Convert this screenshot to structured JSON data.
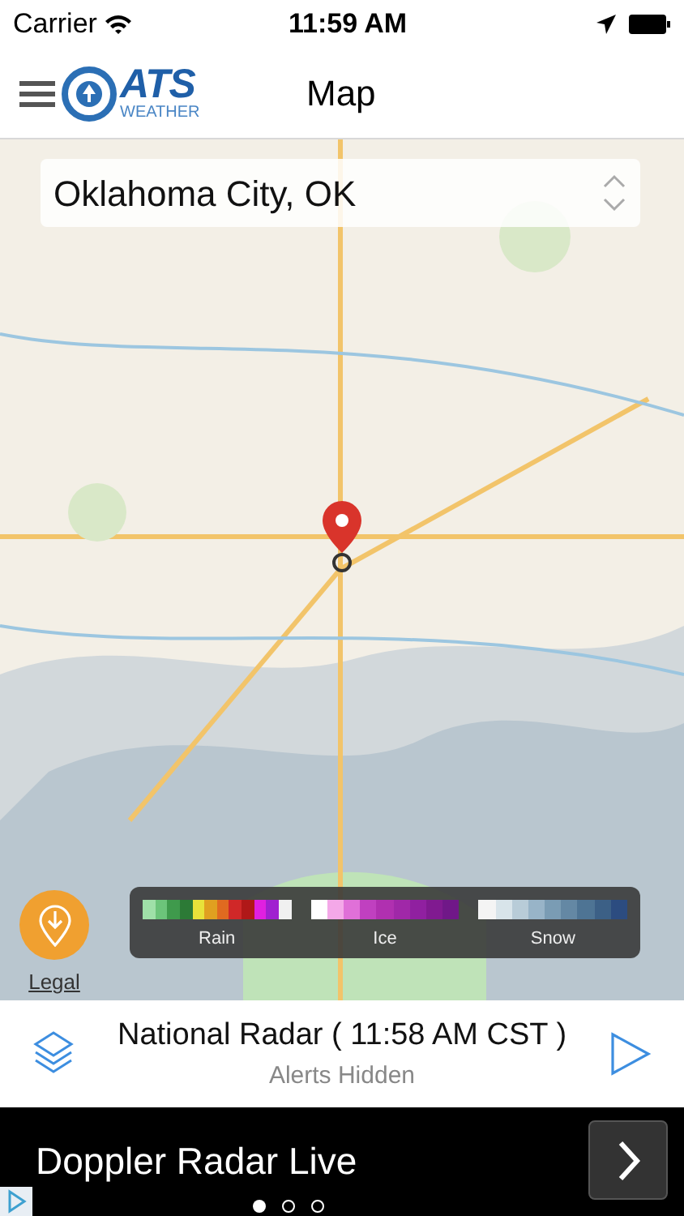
{
  "status_bar": {
    "carrier": "Carrier",
    "time": "11:59 AM"
  },
  "nav": {
    "logo_main": "ATS",
    "logo_sub": "WEATHER",
    "title": "Map"
  },
  "map": {
    "search": {
      "value": "Oklahoma City, OK"
    },
    "legend": [
      {
        "label": "Rain",
        "swatches": [
          {
            "color": "#9fe0a8"
          },
          {
            "color": "#6cc47a"
          },
          {
            "color": "#3f9a4c"
          },
          {
            "color": "#2c7a36"
          },
          {
            "color": "#e8e23a"
          },
          {
            "color": "#e0a020"
          },
          {
            "color": "#e06a20"
          },
          {
            "color": "#d02828"
          },
          {
            "color": "#b01818"
          },
          {
            "color": "#e020e0"
          },
          {
            "color": "#a020d0"
          },
          {
            "color": "#f0f0f0"
          }
        ]
      },
      {
        "label": "Ice",
        "swatches": [
          {
            "color": "#ffffff"
          },
          {
            "color": "#f4a8e8"
          },
          {
            "color": "#e070d8"
          },
          {
            "color": "#c040c0"
          },
          {
            "color": "#b030b0"
          },
          {
            "color": "#a028a8"
          },
          {
            "color": "#9020a0"
          },
          {
            "color": "#801a90"
          },
          {
            "color": "#701888"
          }
        ]
      },
      {
        "label": "Snow",
        "swatches": [
          {
            "color": "#f4f4f4"
          },
          {
            "color": "#d8e4ea"
          },
          {
            "color": "#b8ccd8"
          },
          {
            "color": "#98b4c8"
          },
          {
            "color": "#7a9cb4"
          },
          {
            "color": "#6488a4"
          },
          {
            "color": "#4e7494"
          },
          {
            "color": "#3c6086"
          },
          {
            "color": "#2c4c80"
          }
        ]
      }
    ],
    "legal": "Legal"
  },
  "panel": {
    "title": "National Radar ( 11:58 AM CST )",
    "subtitle": "Alerts Hidden"
  },
  "ad": {
    "text": "Doppler Radar Live",
    "pages": [
      {
        "selected": true
      },
      {
        "selected": false
      },
      {
        "selected": false
      }
    ]
  }
}
